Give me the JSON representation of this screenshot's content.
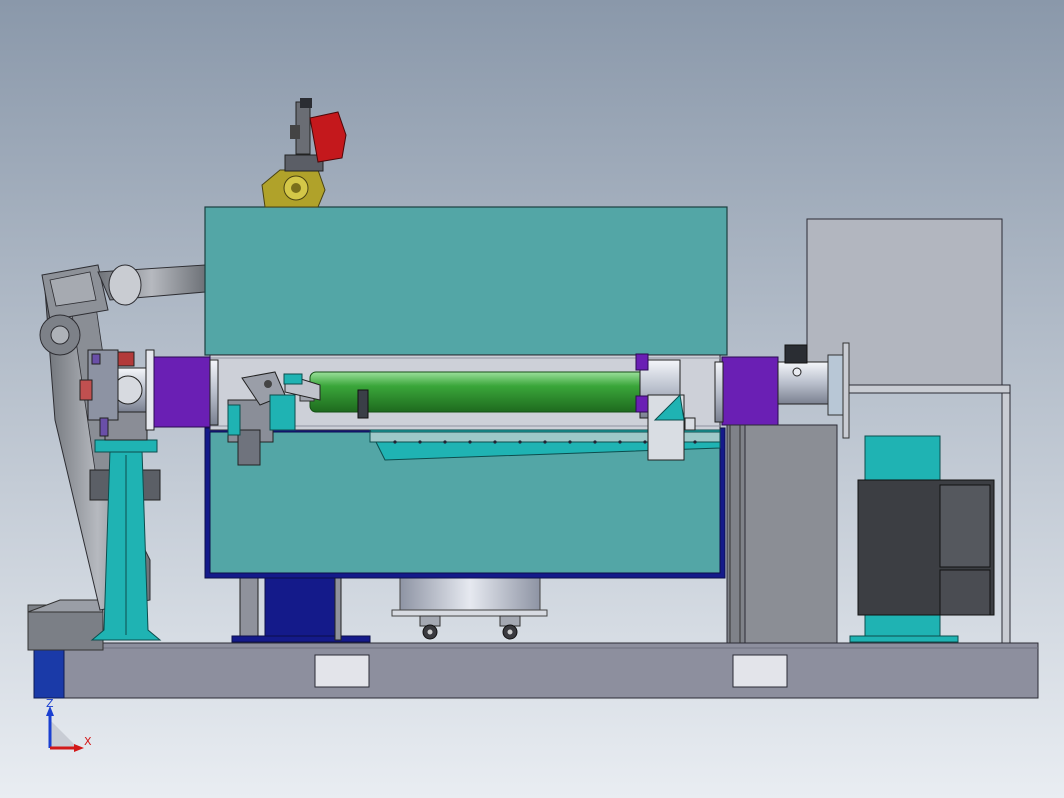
{
  "triad": {
    "z_label": "Z",
    "x_label": "X"
  },
  "colors": {
    "background_top": "#8a98aa",
    "background_bottom": "#e9edf2",
    "cover": "#53a6a6",
    "base": "#8d8f9e",
    "roller": "#3aa63a",
    "flange": "#6a1fb4",
    "pedestal": "#1fb3b3",
    "frame_blue": "#141a8a",
    "cabinet": "#7a7a7a",
    "motor_red": "#c4181c",
    "head_yellow": "#b0a22a",
    "triad_blue": "#1a3fd1",
    "triad_red": "#d21818"
  }
}
